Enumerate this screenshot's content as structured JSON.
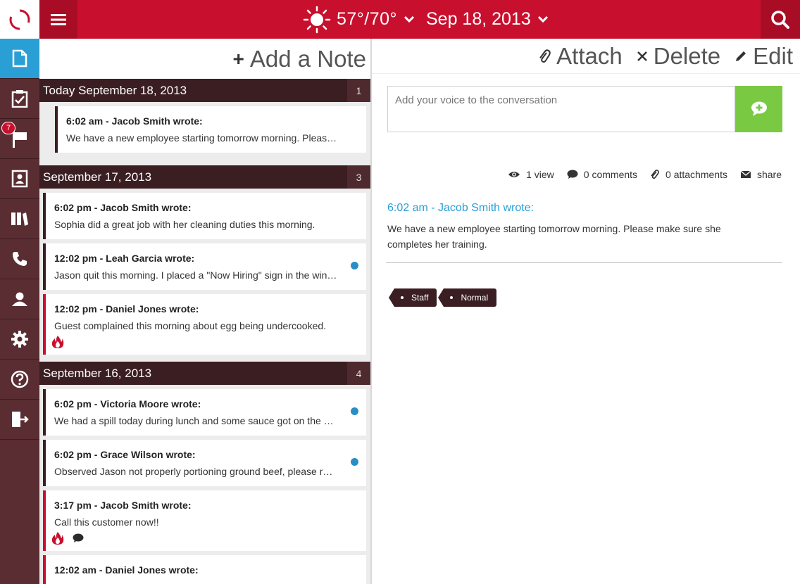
{
  "topbar": {
    "temperature": "57°/70°",
    "date": "Sep 18, 2013",
    "weather_icon": "sun-icon",
    "colors": {
      "brand": "#c8102e",
      "nav": "#5a2d32",
      "accent": "#2a9fd6",
      "send": "#7ac943"
    }
  },
  "nav": {
    "items": [
      {
        "icon": "note-icon",
        "active": true
      },
      {
        "icon": "clipboard-check-icon"
      },
      {
        "icon": "flag-icon",
        "badge": "7"
      },
      {
        "icon": "contact-card-icon"
      },
      {
        "icon": "books-icon"
      },
      {
        "icon": "phone-icon"
      },
      {
        "icon": "user-icon"
      },
      {
        "icon": "gear-icon"
      },
      {
        "icon": "help-icon"
      },
      {
        "icon": "logout-icon"
      }
    ]
  },
  "list": {
    "add_note_label": "Add a Note",
    "groups": [
      {
        "label": "Today September 18, 2013",
        "count": "1",
        "notes": [
          {
            "who": "6:02 am - Jacob Smith wrote:",
            "body": "We have a new employee starting tomorrow morning. Please make sure she completes her training."
          }
        ]
      },
      {
        "label": "September 17, 2013",
        "count": "3",
        "notes": [
          {
            "who": "6:02 pm - Jacob Smith wrote:",
            "body": "Sophia did a great job with her cleaning duties this morning."
          },
          {
            "who": "12:02 pm - Leah Garcia wrote:",
            "body": "Jason quit this morning. I placed a \"Now Hiring\" sign in the window."
          },
          {
            "who": "12:02 pm - Daniel Jones wrote:",
            "body": "Guest complained this morning about egg being undercooked."
          }
        ]
      },
      {
        "label": "September 16, 2013",
        "count": "4",
        "notes": [
          {
            "who": "6:02 pm - Victoria Moore wrote:",
            "body": "We had a spill today during lunch and some sauce got on the carpet."
          },
          {
            "who": "6:02 pm - Grace Wilson wrote:",
            "body": "Observed Jason not properly portioning ground beef, please retrain."
          },
          {
            "who": "3:17 pm - Jacob Smith wrote:",
            "body": "Call this customer now!!"
          },
          {
            "who": "12:02 am - Daniel Jones wrote:",
            "body": ""
          }
        ]
      }
    ]
  },
  "detail": {
    "actions": {
      "attach": "Attach",
      "delete": "Delete",
      "edit": "Edit"
    },
    "comment_placeholder": "Add your voice to the conversation",
    "stats": {
      "views": "1 view",
      "comments": "0 comments",
      "attachments": "0 attachments",
      "share": "share"
    },
    "title": "6:02 am - Jacob Smith wrote:",
    "text": "We have a new employee starting tomorrow morning. Please make sure she completes her training.",
    "tags": [
      "Staff",
      "Normal"
    ]
  }
}
